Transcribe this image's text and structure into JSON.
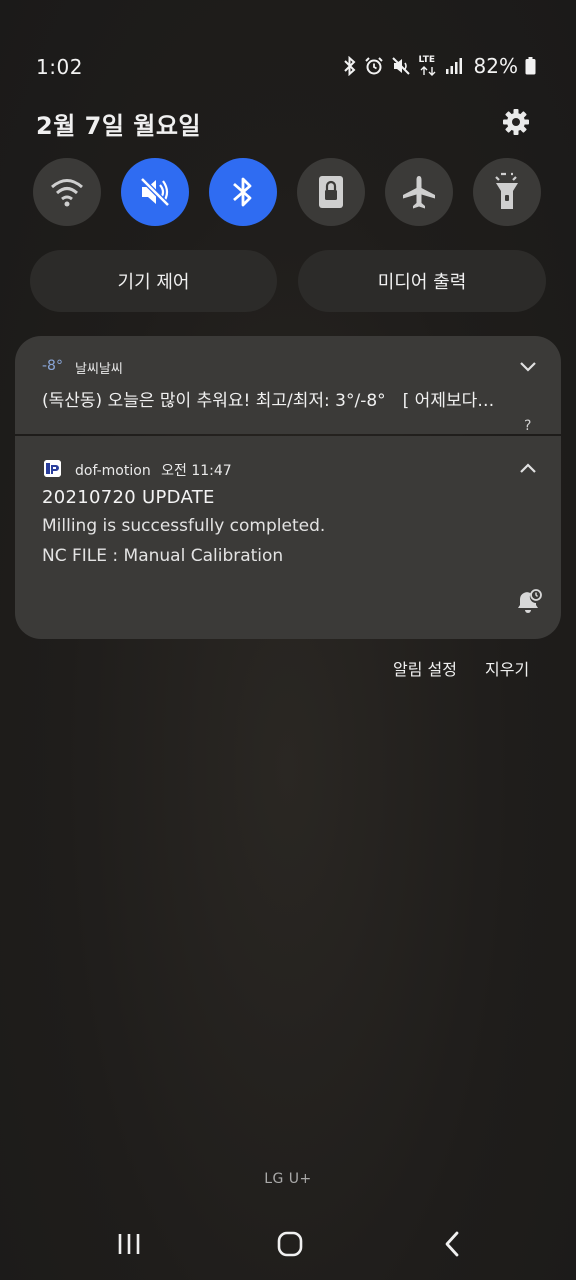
{
  "status_bar": {
    "time": "1:02",
    "network": "LTE",
    "battery": "82%",
    "icons": [
      "bluetooth-icon",
      "alarm-icon",
      "mute-icon",
      "lte-icon",
      "signal-icon",
      "battery-icon"
    ]
  },
  "header": {
    "date": "2월 7일 월요일",
    "settings_icon": "gear-icon"
  },
  "quick_settings": [
    {
      "name": "wifi",
      "icon": "wifi-icon",
      "active": false
    },
    {
      "name": "sound",
      "icon": "mute-icon",
      "active": true
    },
    {
      "name": "bluetooth",
      "icon": "bluetooth-icon",
      "active": true
    },
    {
      "name": "rotation-lock",
      "icon": "lock-icon",
      "active": false
    },
    {
      "name": "airplane",
      "icon": "airplane-icon",
      "active": false
    },
    {
      "name": "flashlight",
      "icon": "flashlight-icon",
      "active": false
    }
  ],
  "pills": {
    "device_control": "기기 제어",
    "media_output": "미디어 출력"
  },
  "notifications": {
    "weather": {
      "temp": "-8°",
      "app": "날씨날씨",
      "body": "(독산동) 오늘은 많이 추워요! 최고/최저: 3°/-8°　[ 어제보다…",
      "sub": "?"
    },
    "dof": {
      "app": "dof-motion",
      "time": "오전 11:47",
      "title": "20210720 UPDATE",
      "line1": "Milling is successfully completed.",
      "line2": "NC FILE : Manual Calibration"
    }
  },
  "actions": {
    "settings": "알림 설정",
    "clear": "지우기"
  },
  "carrier": "LG U+",
  "nav": {
    "recent": "recent-apps-icon",
    "home": "home-icon",
    "back": "back-icon"
  },
  "colors": {
    "accent": "#2f6cf2",
    "tile": "#3b3a38",
    "card": "#3b3a38"
  }
}
